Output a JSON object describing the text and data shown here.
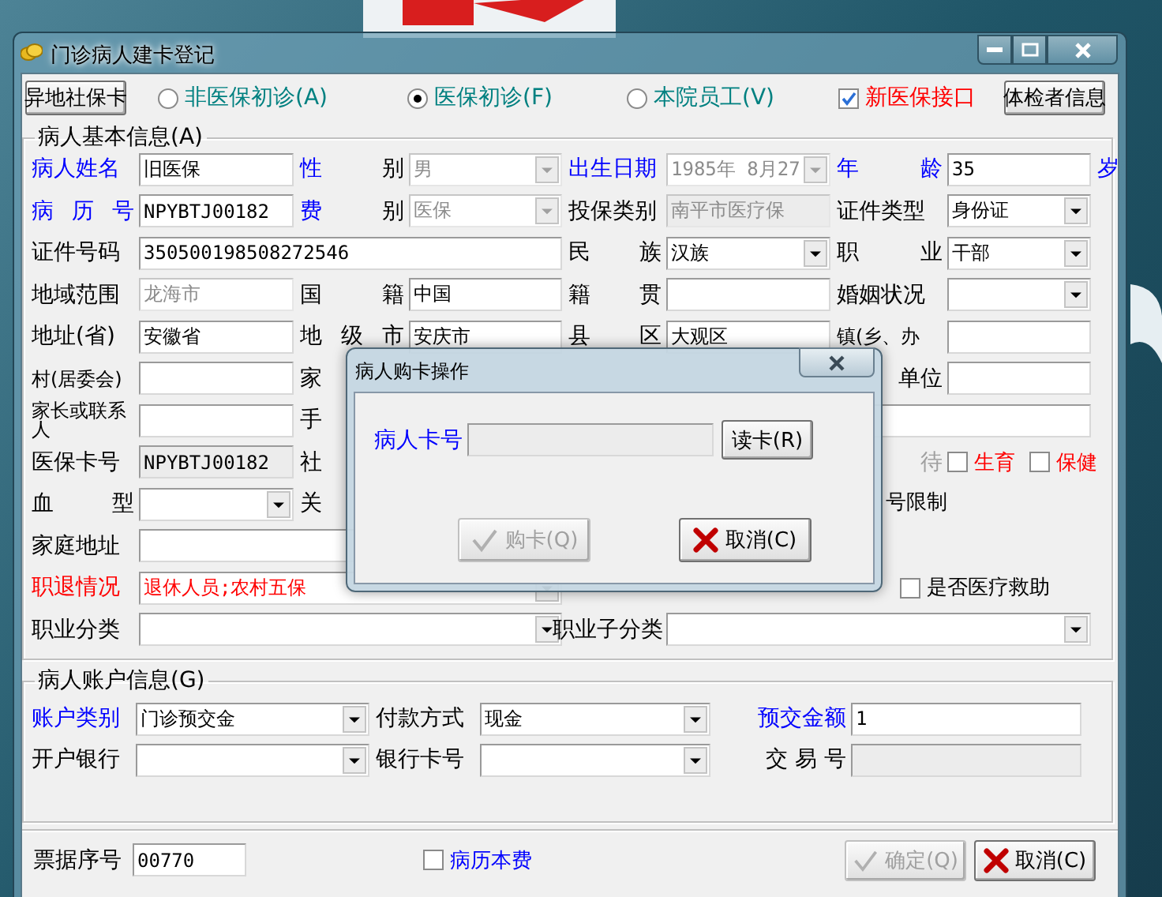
{
  "window": {
    "title": "门诊病人建卡登记"
  },
  "toolbar": [
    {
      "kind": "button",
      "label": "异地社保卡"
    },
    {
      "kind": "radio",
      "label": "非医保初诊(A)",
      "selected": false,
      "color": "#008080"
    },
    {
      "kind": "radio",
      "label": "医保初诊(F)",
      "selected": true,
      "color": "#008080"
    },
    {
      "kind": "radio",
      "label": "本院员工(V)",
      "selected": false,
      "color": "#008080"
    },
    {
      "kind": "check",
      "label": "新医保接口",
      "checked": true,
      "color": "#ff0000"
    },
    {
      "kind": "button",
      "label": "体检者信息"
    }
  ],
  "basic_info": {
    "title": "病人基本信息(A)",
    "rows": [
      {
        "items": [
          {
            "kind": "label",
            "text": "病人姓名",
            "color": "#0000ff"
          },
          {
            "kind": "field",
            "value": "旧医保",
            "disabled": false,
            "readonly": false
          },
          {
            "kind": "label",
            "text": "性",
            "color": "#0000ff"
          },
          {
            "kind": "label",
            "text": "别"
          },
          {
            "kind": "combo",
            "value": "男",
            "disabled": true
          },
          {
            "kind": "label",
            "text": "出生日期",
            "color": "#0000ff"
          },
          {
            "kind": "combo",
            "value": "1985年 8月27",
            "disabled": true
          },
          {
            "kind": "label",
            "text": "年",
            "color": "#0000ff"
          },
          {
            "kind": "label",
            "text": "龄",
            "color": "#0000ff"
          },
          {
            "kind": "field",
            "value": "35",
            "disabled": false,
            "readonly": false
          },
          {
            "kind": "label",
            "text": "岁",
            "color": "#0000ff"
          }
        ]
      },
      {
        "items": [
          {
            "kind": "label",
            "text": "病 历 号",
            "color": "#0000ff"
          },
          {
            "kind": "field",
            "value": "NPYBTJ00182",
            "disabled": false,
            "readonly": false
          },
          {
            "kind": "label",
            "text": "费",
            "color": "#0000ff"
          },
          {
            "kind": "label",
            "text": "别"
          },
          {
            "kind": "combo",
            "value": "医保",
            "disabled": true
          },
          {
            "kind": "label",
            "text": "投保类别"
          },
          {
            "kind": "field",
            "value": "南平市医疗保",
            "disabled": true,
            "readonly": true
          },
          {
            "kind": "label",
            "text": "证件类型"
          },
          {
            "kind": "combo",
            "value": "身份证",
            "disabled": false
          }
        ]
      },
      {
        "items": [
          {
            "kind": "label",
            "text": "证件号码"
          },
          {
            "kind": "field",
            "value": "350500198508272546",
            "disabled": false,
            "readonly": false
          },
          {
            "kind": "label",
            "text": "民 族"
          },
          {
            "kind": "combo",
            "value": "汉族",
            "disabled": false
          },
          {
            "kind": "label",
            "text": "职 业"
          },
          {
            "kind": "combo",
            "value": "干部",
            "disabled": false
          }
        ]
      },
      {
        "items": [
          {
            "kind": "label",
            "text": "地域范围"
          },
          {
            "kind": "field",
            "value": "龙海市",
            "disabled": true,
            "readonly": false
          },
          {
            "kind": "label",
            "text": "国 籍"
          },
          {
            "kind": "field",
            "value": "中国",
            "disabled": false,
            "readonly": false
          },
          {
            "kind": "label",
            "text": "籍 贯"
          },
          {
            "kind": "field",
            "disabled": false,
            "readonly": false
          },
          {
            "kind": "label",
            "text": "婚姻状况"
          },
          {
            "kind": "combo",
            "disabled": false
          }
        ]
      },
      {
        "items": [
          {
            "kind": "label",
            "text": "地址(省)"
          },
          {
            "kind": "field",
            "value": "安徽省",
            "disabled": false,
            "readonly": false
          },
          {
            "kind": "label",
            "text": "地 级 市"
          },
          {
            "kind": "field",
            "value": "安庆市",
            "disabled": false,
            "readonly": false
          },
          {
            "kind": "label",
            "text": "县 区"
          },
          {
            "kind": "field",
            "value": "大观区",
            "disabled": false,
            "readonly": false
          },
          {
            "kind": "label",
            "text": "镇(乡、办"
          },
          {
            "kind": "field",
            "disabled": false,
            "readonly": false
          }
        ]
      },
      {
        "items": [
          {
            "kind": "label",
            "text": "村(居委会)"
          },
          {
            "kind": "field",
            "disabled": false,
            "readonly": false
          },
          {
            "kind": "label",
            "text": "家"
          },
          {
            "kind": "label",
            "text": "单位"
          },
          {
            "kind": "field",
            "disabled": false,
            "readonly": false
          }
        ]
      },
      {
        "items": [
          {
            "kind": "label",
            "text": "家长或联系人"
          },
          {
            "kind": "field",
            "disabled": false,
            "readonly": false
          },
          {
            "kind": "label",
            "text": "手"
          },
          {
            "kind": "field",
            "disabled": false,
            "readonly": false
          }
        ]
      },
      {
        "items": [
          {
            "kind": "label",
            "text": "医保卡号"
          },
          {
            "kind": "field",
            "value": "NPYBTJ00182",
            "disabled": false,
            "readonly": true
          },
          {
            "kind": "label",
            "text": "社"
          },
          {
            "kind": "label",
            "text": "待",
            "color": "#a0a0a0"
          },
          {
            "kind": "check",
            "label": "生育",
            "checked": false,
            "color": "#ff0000"
          },
          {
            "kind": "check",
            "label": "保健",
            "checked": false,
            "color": "#ff0000"
          }
        ]
      },
      {
        "items": [
          {
            "kind": "label",
            "text": "血 型"
          },
          {
            "kind": "combo",
            "disabled": false
          },
          {
            "kind": "label",
            "text": "关"
          },
          {
            "kind": "label",
            "text": "号限制"
          }
        ]
      },
      {
        "items": [
          {
            "kind": "label",
            "text": "家庭地址"
          },
          {
            "kind": "field",
            "disabled": false,
            "readonly": false
          }
        ]
      },
      {
        "items": [
          {
            "kind": "label",
            "text": "职退情况",
            "color": "#ff0000"
          },
          {
            "kind": "combo",
            "value": "退休人员;农村五保",
            "disabled": false,
            "color": "#ff0000"
          },
          {
            "kind": "check",
            "label": "是否医疗救助",
            "checked": false
          }
        ]
      },
      {
        "items": [
          {
            "kind": "label",
            "text": "职业分类"
          },
          {
            "kind": "combo",
            "disabled": false
          },
          {
            "kind": "label",
            "text": "职业子分类"
          },
          {
            "kind": "combo",
            "disabled": false
          }
        ]
      }
    ]
  },
  "account_info": {
    "title": "病人账户信息(G)",
    "rows": [
      {
        "items": [
          {
            "kind": "label",
            "text": "账户类别",
            "color": "#0000ff"
          },
          {
            "kind": "combo",
            "value": "门诊预交金",
            "disabled": false
          },
          {
            "kind": "label",
            "text": "付款方式"
          },
          {
            "kind": "combo",
            "value": "现金",
            "disabled": false
          },
          {
            "kind": "label",
            "text": "预交金额",
            "color": "#0000ff"
          },
          {
            "kind": "field",
            "value": "1",
            "disabled": false,
            "readonly": false
          }
        ]
      },
      {
        "items": [
          {
            "kind": "label",
            "text": "开户银行"
          },
          {
            "kind": "combo",
            "disabled": false
          },
          {
            "kind": "label",
            "text": "银行卡号"
          },
          {
            "kind": "combo",
            "disabled": false
          },
          {
            "kind": "label",
            "text": "交 易 号"
          },
          {
            "kind": "field",
            "disabled": false,
            "readonly": true
          }
        ]
      }
    ]
  },
  "footer": [
    {
      "kind": "label",
      "text": "票据序号"
    },
    {
      "kind": "field",
      "value": "00770",
      "disabled": false,
      "readonly": false
    },
    {
      "kind": "check",
      "label": "病历本费",
      "checked": false,
      "color": "#0000ff"
    },
    {
      "kind": "button",
      "label": "确定(Q)",
      "disabled": true
    },
    {
      "kind": "button",
      "label": "取消(C)",
      "disabled": false
    }
  ],
  "dialog": {
    "title": "病人购卡操作",
    "items": [
      {
        "kind": "label",
        "text": "病人卡号",
        "color": "#0000ff"
      },
      {
        "kind": "field",
        "disabled": false,
        "readonly": true
      },
      {
        "kind": "button",
        "label": "读卡(R)",
        "disabled": false
      },
      {
        "kind": "button",
        "label": "购卡(Q)",
        "disabled": true
      },
      {
        "kind": "button",
        "label": "取消(C)",
        "disabled": false
      }
    ]
  }
}
